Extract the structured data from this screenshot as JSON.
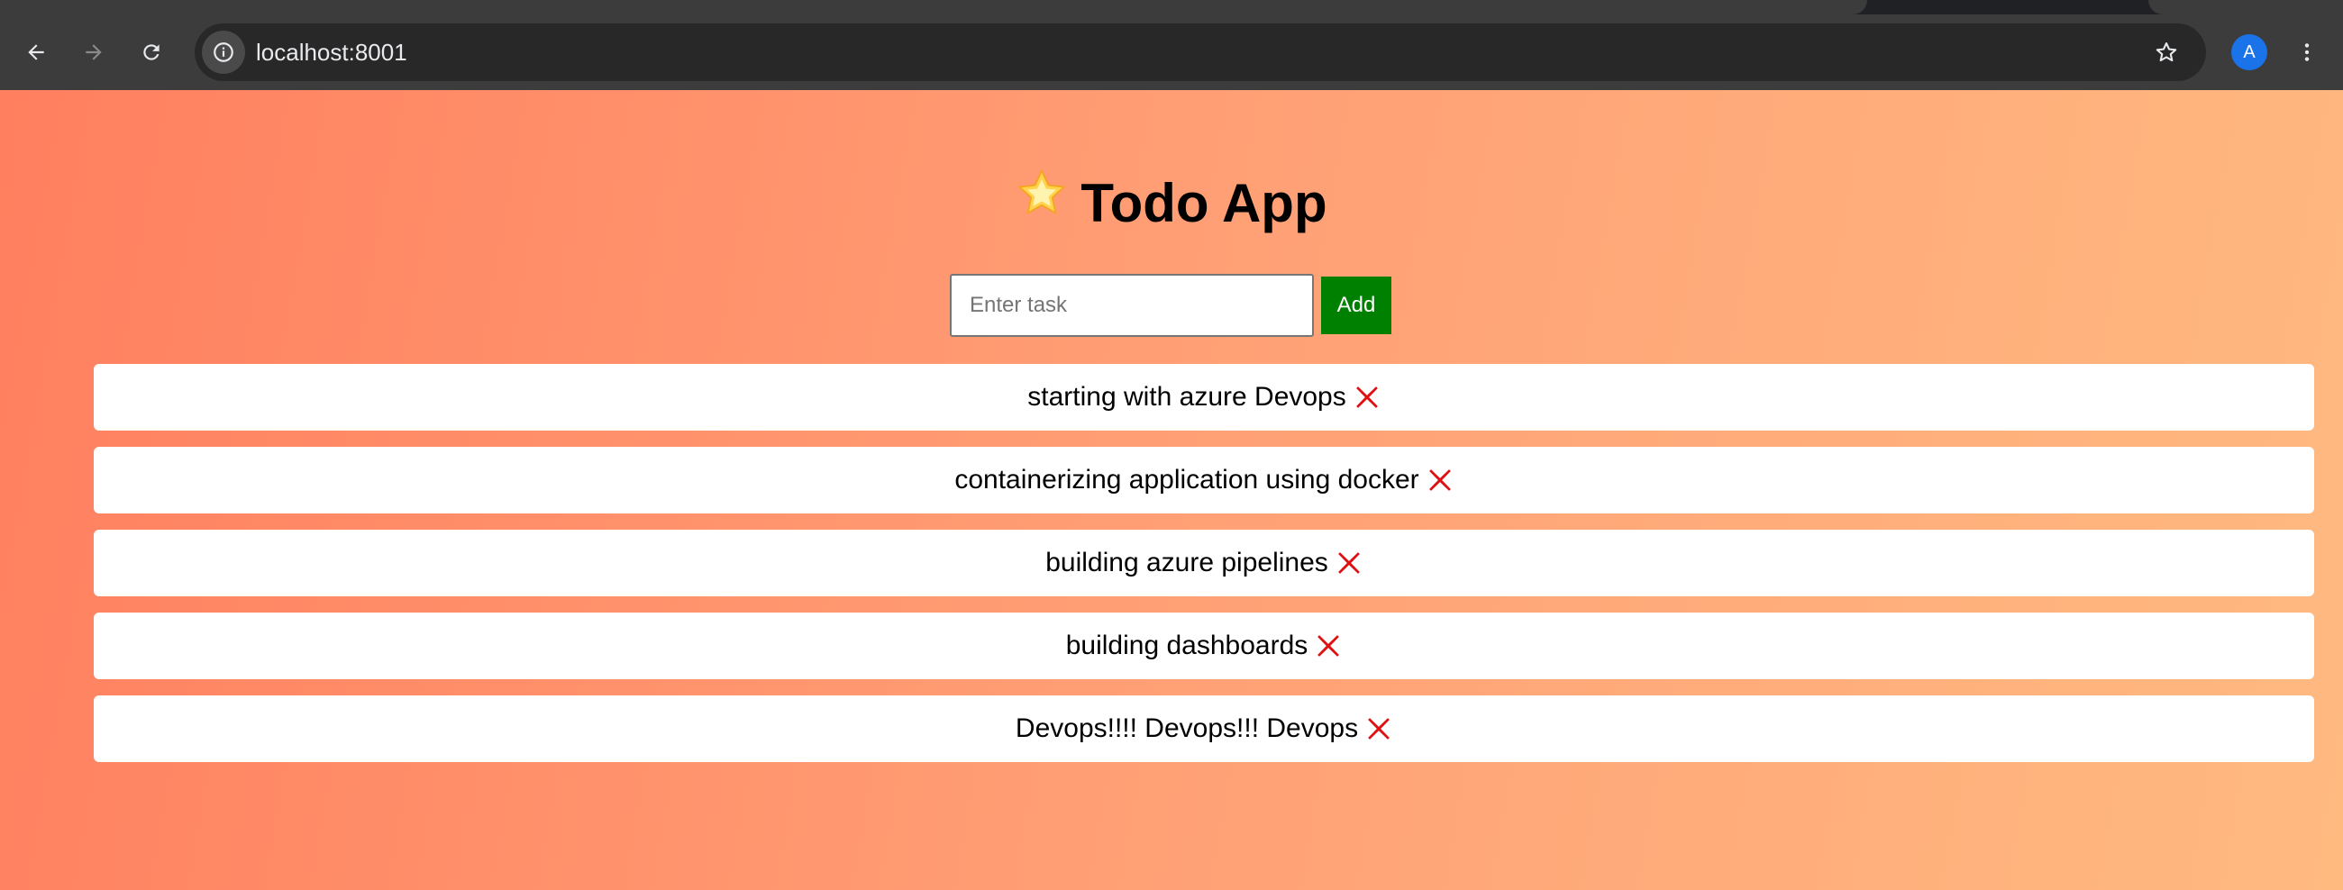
{
  "browser": {
    "url": "localhost:8001",
    "profile_initial": "A",
    "icons": {
      "back": "arrow-left-icon",
      "forward": "arrow-right-icon",
      "reload": "reload-icon",
      "site_info": "info-icon",
      "bookmark": "star-outline-icon",
      "menu": "more-vertical-icon"
    }
  },
  "app": {
    "title": "Todo App",
    "title_icon": "glowing-star-icon",
    "input_placeholder": "Enter task",
    "input_value": "",
    "add_label": "Add",
    "add_color": "#008000",
    "delete_icon": "cross-mark-icon",
    "delete_color": "#dd1111",
    "tasks": [
      {
        "text": "starting with azure Devops"
      },
      {
        "text": "containerizing application using docker"
      },
      {
        "text": "building azure pipelines"
      },
      {
        "text": "building dashboards"
      },
      {
        "text": "Devops!!!! Devops!!! Devops"
      }
    ]
  },
  "colors": {
    "gradient_start": "#ff7f5f",
    "gradient_end": "#ffba80",
    "chrome_bg": "#3c3c3c",
    "omnibox_bg": "#282828",
    "avatar_bg": "#1a73e8"
  }
}
